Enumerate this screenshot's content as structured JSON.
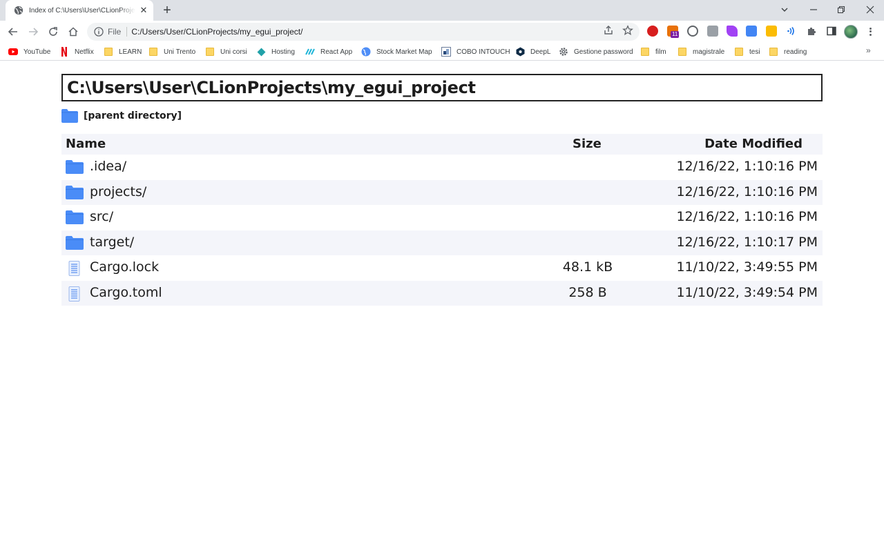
{
  "browser": {
    "tab": {
      "title": "Index of C:\\Users\\User\\CLionProjects\\my_egui_project\\"
    },
    "omnibox": {
      "scheme": "File",
      "url": "C:/Users/User/CLionProjects/my_egui_project/"
    },
    "extensions": [
      {
        "icon": "opera-red-icon",
        "color": "#d71e1e"
      },
      {
        "icon": "tab-counter-icon",
        "badge": "11",
        "color": "#e8710a"
      },
      {
        "icon": "gauge-icon",
        "color": "#5f6368"
      },
      {
        "icon": "code-icon",
        "color": "#9aa0a6"
      },
      {
        "icon": "feather-icon",
        "color": "#a142f4"
      },
      {
        "icon": "translate-icon",
        "color": "#4285f4"
      },
      {
        "icon": "keep-icon",
        "color": "#fbbc04"
      },
      {
        "icon": "wifi-icon",
        "color": "#1a73e8"
      },
      {
        "icon": "puzzle-icon",
        "color": "#5f6368"
      }
    ],
    "bookmarks": [
      {
        "label": "YouTube",
        "icon": "youtube-icon"
      },
      {
        "label": "Netflix",
        "icon": "netflix-icon"
      },
      {
        "label": "LEARN",
        "icon": "folder-icon"
      },
      {
        "label": "Uni Trento",
        "icon": "folder-icon"
      },
      {
        "label": "Uni corsi",
        "icon": "folder-icon"
      },
      {
        "label": "Hosting",
        "icon": "diamond-icon"
      },
      {
        "label": "React App",
        "icon": "react-icon"
      },
      {
        "label": "Stock Market Map",
        "icon": "globe-icon"
      },
      {
        "label": "COBO INTOUCH",
        "icon": "cobo-icon"
      },
      {
        "label": "DeepL",
        "icon": "deepl-icon"
      },
      {
        "label": "Gestione password",
        "icon": "gear-icon"
      },
      {
        "label": "film",
        "icon": "folder-icon"
      },
      {
        "label": "magistrale",
        "icon": "folder-icon"
      },
      {
        "label": "tesi",
        "icon": "folder-icon"
      },
      {
        "label": "reading",
        "icon": "folder-icon"
      }
    ],
    "bookmarks_more": "»"
  },
  "page": {
    "heading": "C:\\Users\\User\\CLionProjects\\my_egui_project",
    "parent_link": "[parent directory]",
    "columns": {
      "name": "Name",
      "size": "Size",
      "date": "Date Modified"
    },
    "entries": [
      {
        "type": "folder",
        "name": ".idea/",
        "size": "",
        "date": "12/16/22, 1:10:16 PM"
      },
      {
        "type": "folder",
        "name": "projects/",
        "size": "",
        "date": "12/16/22, 1:10:16 PM"
      },
      {
        "type": "folder",
        "name": "src/",
        "size": "",
        "date": "12/16/22, 1:10:16 PM"
      },
      {
        "type": "folder",
        "name": "target/",
        "size": "",
        "date": "12/16/22, 1:10:17 PM"
      },
      {
        "type": "file",
        "name": "Cargo.lock",
        "size": "48.1 kB",
        "date": "11/10/22, 3:49:55 PM"
      },
      {
        "type": "file",
        "name": "Cargo.toml",
        "size": "258 B",
        "date": "11/10/22, 3:49:54 PM"
      }
    ],
    "colors": {
      "folder": "#4a8cf7",
      "row_alt": "#f4f5fa",
      "text": "#1d1d1d"
    }
  }
}
